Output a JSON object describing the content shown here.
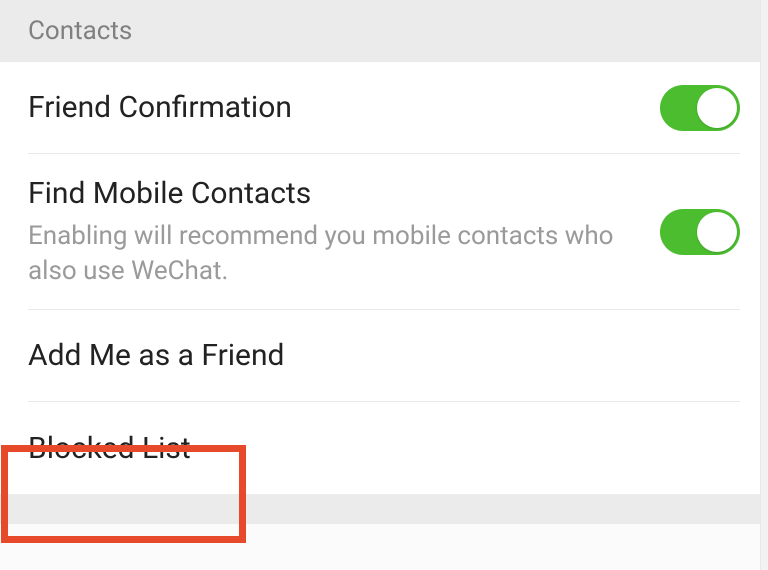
{
  "section_header": "Contacts",
  "rows": {
    "friend_confirmation": {
      "title": "Friend Confirmation",
      "toggle_on": true
    },
    "find_mobile_contacts": {
      "title": "Find Mobile Contacts",
      "description": "Enabling will recommend you mobile contacts who also use WeChat.",
      "toggle_on": true
    },
    "add_me": {
      "title": "Add Me as a Friend"
    },
    "blocked_list": {
      "title": "Blocked List"
    }
  },
  "colors": {
    "toggle_on": "#4bbd2f",
    "highlight": "#e74a2b"
  }
}
